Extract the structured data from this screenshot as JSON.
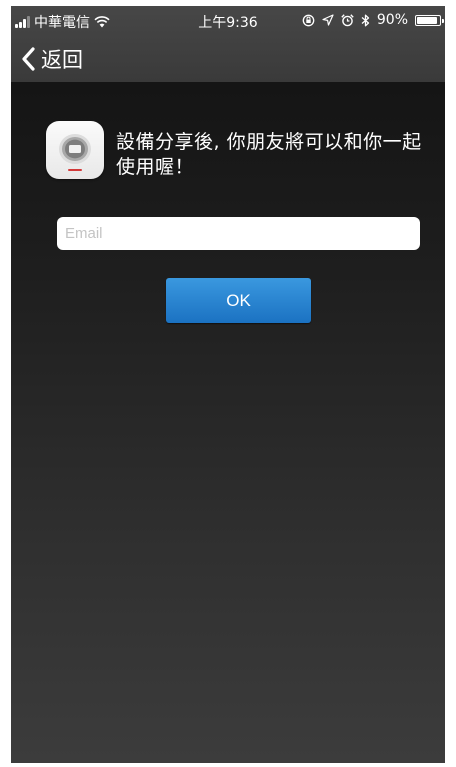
{
  "status_bar": {
    "carrier": "中華電信",
    "time": "上午9:36",
    "battery": "90%",
    "battery_level": 0.9
  },
  "nav": {
    "back_label": "返回"
  },
  "main": {
    "message": "設備分享後, 你朋友將可以和你一起使用喔！",
    "email_placeholder": "Email",
    "email_value": "",
    "ok_label": "OK"
  },
  "colors": {
    "accent": "#2584d4",
    "background_top": "#111111",
    "background_bottom": "#3c3c3c"
  },
  "icons": [
    "signal-icon",
    "wifi-icon",
    "orientation-lock-icon",
    "location-icon",
    "alarm-icon",
    "bluetooth-icon",
    "battery-icon",
    "chevron-left-icon",
    "device-icon"
  ]
}
